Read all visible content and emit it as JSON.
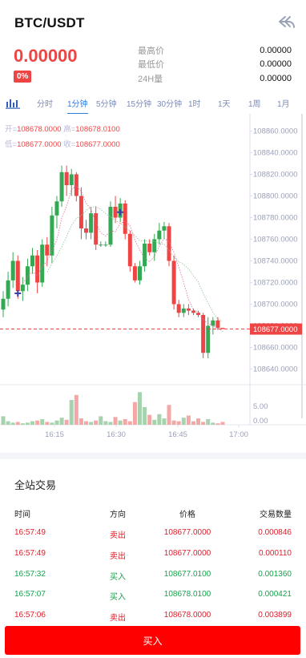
{
  "header": {
    "pair": "BTC/USDT",
    "price": "0.00000",
    "change": "0%",
    "stats": [
      {
        "label": "最高价",
        "value": "0.00000"
      },
      {
        "label": "最低价",
        "value": "0.00000"
      },
      {
        "label": "24H量",
        "value": "0.00000"
      }
    ]
  },
  "intervals": [
    "分时",
    "1分钟",
    "5分钟",
    "15分钟",
    "30分钟",
    "1时",
    "1天",
    "1周",
    "1月"
  ],
  "active_interval": "1分钟",
  "ohlc": {
    "open_label": "开=",
    "open": "108678.0000",
    "high_label": "高=",
    "high": "108678.0100",
    "low_label": "低=",
    "low": "108677.0000",
    "close_label": "收=",
    "close": "108677.0000"
  },
  "colors": {
    "up": "#34a853",
    "down": "#ef4444",
    "accent": "#2f7de1",
    "buy_button": "#ff0000"
  },
  "chart_data": {
    "type": "candlestick",
    "y_ticks": [
      "108860.0000",
      "108840.0000",
      "108820.0000",
      "108800.0000",
      "108780.0000",
      "108760.0000",
      "108740.0000",
      "108720.0000",
      "108700.0000",
      "108680.0000",
      "108660.0000",
      "108640.0000"
    ],
    "current_price_label": "108677.0000",
    "current_price": 108677.0,
    "x_ticks": [
      "16:15",
      "16:30",
      "16:45",
      "17:00"
    ],
    "volume_ticks": [
      "5.00",
      "0.00"
    ],
    "ylim": [
      108630,
      108870
    ],
    "candles": [
      {
        "o": 108695,
        "h": 108712,
        "l": 108688,
        "c": 108705
      },
      {
        "o": 108705,
        "h": 108730,
        "l": 108698,
        "c": 108722
      },
      {
        "o": 108722,
        "h": 108748,
        "l": 108715,
        "c": 108740
      },
      {
        "o": 108740,
        "h": 108745,
        "l": 108705,
        "c": 108712
      },
      {
        "o": 108712,
        "h": 108725,
        "l": 108703,
        "c": 108718
      },
      {
        "o": 108718,
        "h": 108742,
        "l": 108712,
        "c": 108735
      },
      {
        "o": 108735,
        "h": 108752,
        "l": 108728,
        "c": 108745
      },
      {
        "o": 108745,
        "h": 108750,
        "l": 108710,
        "c": 108720
      },
      {
        "o": 108720,
        "h": 108760,
        "l": 108716,
        "c": 108755
      },
      {
        "o": 108755,
        "h": 108762,
        "l": 108735,
        "c": 108745
      },
      {
        "o": 108745,
        "h": 108790,
        "l": 108738,
        "c": 108782
      },
      {
        "o": 108782,
        "h": 108800,
        "l": 108770,
        "c": 108795
      },
      {
        "o": 108795,
        "h": 108828,
        "l": 108790,
        "c": 108822
      },
      {
        "o": 108822,
        "h": 108828,
        "l": 108800,
        "c": 108810
      },
      {
        "o": 108810,
        "h": 108825,
        "l": 108800,
        "c": 108820
      },
      {
        "o": 108820,
        "h": 108822,
        "l": 108795,
        "c": 108800
      },
      {
        "o": 108800,
        "h": 108808,
        "l": 108760,
        "c": 108770
      },
      {
        "o": 108770,
        "h": 108778,
        "l": 108760,
        "c": 108766
      },
      {
        "o": 108766,
        "h": 108790,
        "l": 108760,
        "c": 108784
      },
      {
        "o": 108784,
        "h": 108790,
        "l": 108750,
        "c": 108755
      },
      {
        "o": 108755,
        "h": 108758,
        "l": 108753,
        "c": 108755
      },
      {
        "o": 108755,
        "h": 108758,
        "l": 108753,
        "c": 108755
      },
      {
        "o": 108755,
        "h": 108795,
        "l": 108753,
        "c": 108790
      },
      {
        "o": 108790,
        "h": 108800,
        "l": 108775,
        "c": 108780
      },
      {
        "o": 108780,
        "h": 108798,
        "l": 108776,
        "c": 108793
      },
      {
        "o": 108793,
        "h": 108796,
        "l": 108760,
        "c": 108765
      },
      {
        "o": 108765,
        "h": 108768,
        "l": 108730,
        "c": 108735
      },
      {
        "o": 108735,
        "h": 108738,
        "l": 108720,
        "c": 108722
      },
      {
        "o": 108722,
        "h": 108740,
        "l": 108718,
        "c": 108735
      },
      {
        "o": 108735,
        "h": 108760,
        "l": 108730,
        "c": 108756
      },
      {
        "o": 108756,
        "h": 108760,
        "l": 108745,
        "c": 108748
      },
      {
        "o": 108748,
        "h": 108765,
        "l": 108740,
        "c": 108760
      },
      {
        "o": 108760,
        "h": 108775,
        "l": 108755,
        "c": 108768
      },
      {
        "o": 108768,
        "h": 108776,
        "l": 108760,
        "c": 108772
      },
      {
        "o": 108772,
        "h": 108775,
        "l": 108735,
        "c": 108740
      },
      {
        "o": 108740,
        "h": 108745,
        "l": 108695,
        "c": 108700
      },
      {
        "o": 108700,
        "h": 108704,
        "l": 108688,
        "c": 108692
      },
      {
        "o": 108692,
        "h": 108700,
        "l": 108688,
        "c": 108696
      },
      {
        "o": 108696,
        "h": 108700,
        "l": 108690,
        "c": 108694
      },
      {
        "o": 108694,
        "h": 108696,
        "l": 108690,
        "c": 108692
      },
      {
        "o": 108692,
        "h": 108694,
        "l": 108688,
        "c": 108690
      },
      {
        "o": 108690,
        "h": 108692,
        "l": 108650,
        "c": 108655
      },
      {
        "o": 108655,
        "h": 108688,
        "l": 108650,
        "c": 108680
      },
      {
        "o": 108680,
        "h": 108688,
        "l": 108672,
        "c": 108685
      },
      {
        "o": 108685,
        "h": 108688,
        "l": 108676,
        "c": 108678
      },
      {
        "o": 108678,
        "h": 108678.01,
        "l": 108677,
        "c": 108677
      }
    ],
    "volumes": [
      1.2,
      0.5,
      0.3,
      0.4,
      0.2,
      0.3,
      0.5,
      0.6,
      0.8,
      0.4,
      0.3,
      0.6,
      1.0,
      0.7,
      3.5,
      4.2,
      0.9,
      0.5,
      0.4,
      0.6,
      1.2,
      0.5,
      0.4,
      1.1,
      0.6,
      0.8,
      0.5,
      3.2,
      4.6,
      2.5,
      1.4,
      0.7,
      1.5,
      0.9,
      2.8,
      0.6,
      0.5,
      1.0,
      1.3,
      0.5,
      0.9,
      0.4,
      0.8,
      0.3,
      0.2,
      0.4
    ],
    "xlabel": "",
    "ylabel": ""
  },
  "trades": {
    "title": "全站交易",
    "headers": [
      "时间",
      "方向",
      "价格",
      "交易数量"
    ],
    "rows": [
      {
        "time": "16:57:49",
        "side": "卖出",
        "price": "108677.0000",
        "qty": "0.000846",
        "type": "sell"
      },
      {
        "time": "16:57:49",
        "side": "卖出",
        "price": "108677.0000",
        "qty": "0.000110",
        "type": "sell"
      },
      {
        "time": "16:57:32",
        "side": "买入",
        "price": "108677.0100",
        "qty": "0.001360",
        "type": "buy"
      },
      {
        "time": "16:57:07",
        "side": "买入",
        "price": "108678.0100",
        "qty": "0.000421",
        "type": "buy"
      },
      {
        "time": "16:57:06",
        "side": "卖出",
        "price": "108678.0000",
        "qty": "0.003899",
        "type": "sell"
      }
    ]
  },
  "buy_button": "买入"
}
